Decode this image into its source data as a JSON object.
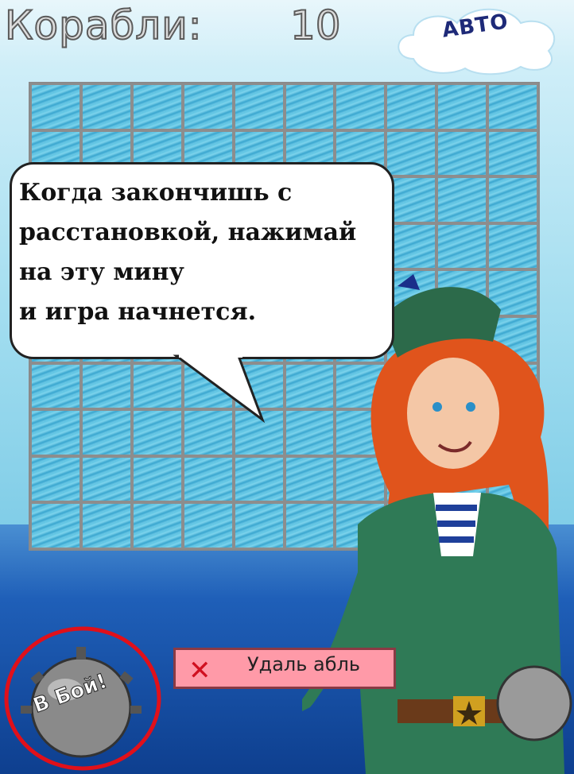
{
  "header": {
    "ships_label": "Корабли:",
    "ships_count": "10"
  },
  "auto_button": {
    "label": "АВТО"
  },
  "board": {
    "rows": 10,
    "cols": 10
  },
  "speech_bubble": {
    "lines": [
      "Когда закончишь с",
      "расстановкой, нажимай",
      "на эту мину",
      "и игра начнется."
    ]
  },
  "remove_button": {
    "label": "Удаль   абль",
    "icon": "x-icon"
  },
  "battle_mine": {
    "label": "В Бой!",
    "icon": "sea-mine-icon",
    "highlight_color": "#e0101a"
  },
  "colors": {
    "sea_dark": "#0e3f8f",
    "sky": "#cfeef8",
    "highlight": "#e0101a"
  }
}
